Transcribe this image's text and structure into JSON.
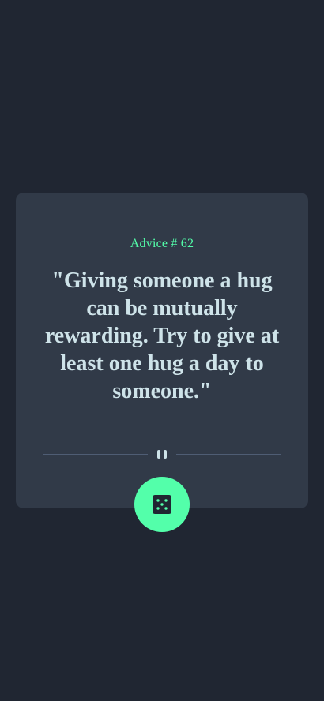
{
  "advice": {
    "label": "Advice # 62",
    "quote": "\"Giving someone a hug can be mutually rewarding. Try to give at least one hug a day to someone.\""
  },
  "icons": {
    "divider": "pause-icon",
    "button": "dice-icon"
  },
  "colors": {
    "background": "#202632",
    "card": "#313a48",
    "accent": "#53ffaa",
    "text": "#cee3e9",
    "divider": "#4f5d74"
  }
}
